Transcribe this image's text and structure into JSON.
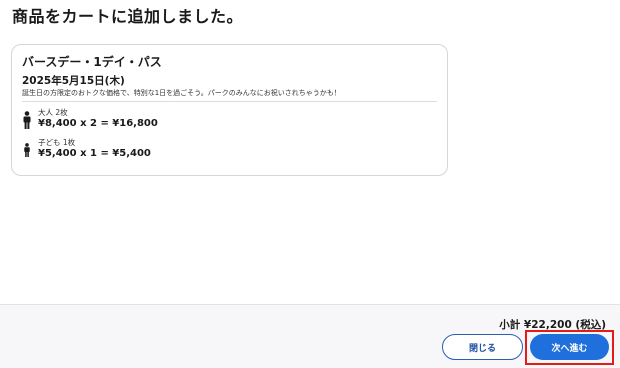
{
  "page": {
    "title": "商品をカートに追加しました。"
  },
  "card": {
    "title": "バースデー・1デイ・パス",
    "date": "2025年5月15日(木)",
    "description": "誕生日の方限定のおトクな価格で、特別な1日を過ごそう。パークのみんなにお祝いされちゃうかも！"
  },
  "tickets": [
    {
      "type": "大人 2枚",
      "price": "¥8,400 x 2 = ¥16,800",
      "icon": "adult-person-icon"
    },
    {
      "type": "子ども 1枚",
      "price": "¥5,400 x 1 = ¥5,400",
      "icon": "child-person-icon"
    }
  ],
  "footer": {
    "subtotal": "小計 ¥22,200 (税込)",
    "close_label": "閉じる",
    "next_label": "次へ進む"
  },
  "colors": {
    "primary": "#1f6fdc",
    "outline": "#2a5fb8",
    "highlight": "#e31b1b"
  }
}
